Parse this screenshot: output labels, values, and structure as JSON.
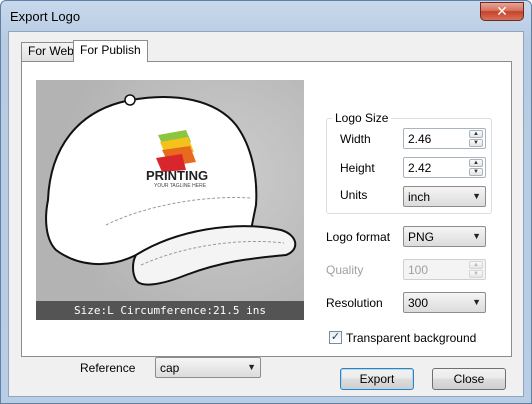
{
  "window": {
    "title": "Export Logo",
    "close_glyph": "✕"
  },
  "tabs": [
    {
      "label": "For Web",
      "active": false
    },
    {
      "label": "For Publish",
      "active": true
    }
  ],
  "preview": {
    "logo_text": "PRINTING",
    "logo_tagline": "YOUR TAGLINE HERE",
    "status": "Size:L  Circumference:21.5 ins"
  },
  "reference": {
    "label": "Reference",
    "value": "cap"
  },
  "logo_size": {
    "legend": "Logo Size",
    "width": {
      "label": "Width",
      "value": "2.46"
    },
    "height": {
      "label": "Height",
      "value": "2.42"
    },
    "units": {
      "label": "Units",
      "value": "inch"
    }
  },
  "logo_format": {
    "label": "Logo format",
    "value": "PNG"
  },
  "quality": {
    "label": "Quality",
    "value": "100",
    "enabled": false
  },
  "resolution": {
    "label": "Resolution",
    "value": "300"
  },
  "transparent": {
    "label": "Transparent background",
    "checked": true
  },
  "buttons": {
    "export": "Export",
    "close": "Close"
  },
  "colors": {
    "logo_orange": "#e86a1f",
    "logo_red": "#d9262c",
    "logo_yellow": "#f4c21b",
    "logo_green": "#8cc63f"
  }
}
